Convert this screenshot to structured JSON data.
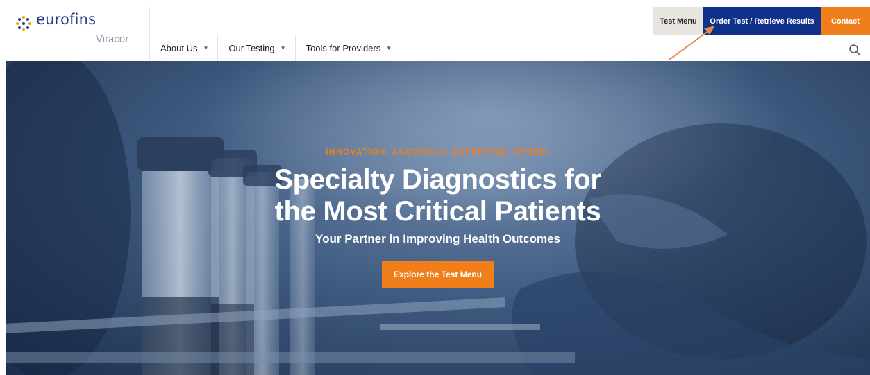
{
  "brand": {
    "name": "eurofins",
    "sub": "Viracor",
    "icon": "eurofins-dots-icon"
  },
  "util_nav": {
    "test_menu": "Test Menu",
    "order_test": "Order Test / Retrieve Results",
    "contact": "Contact"
  },
  "main_nav": {
    "items": [
      {
        "label": "About Us"
      },
      {
        "label": "Our Testing"
      },
      {
        "label": "Tools for Providers"
      }
    ],
    "search_icon": "search-icon"
  },
  "hero": {
    "tagline": "INNOVATION. ACCURACY. EXPERTISE. SPEED.",
    "title_line1": "Specialty Diagnostics for",
    "title_line2": "the Most Critical Patients",
    "subtitle": "Your Partner in Improving Health Outcomes",
    "cta": "Explore the Test Menu"
  },
  "colors": {
    "brand_blue": "#10318a",
    "accent_orange": "#f07e1a",
    "test_menu_bg": "#e8e4df"
  }
}
